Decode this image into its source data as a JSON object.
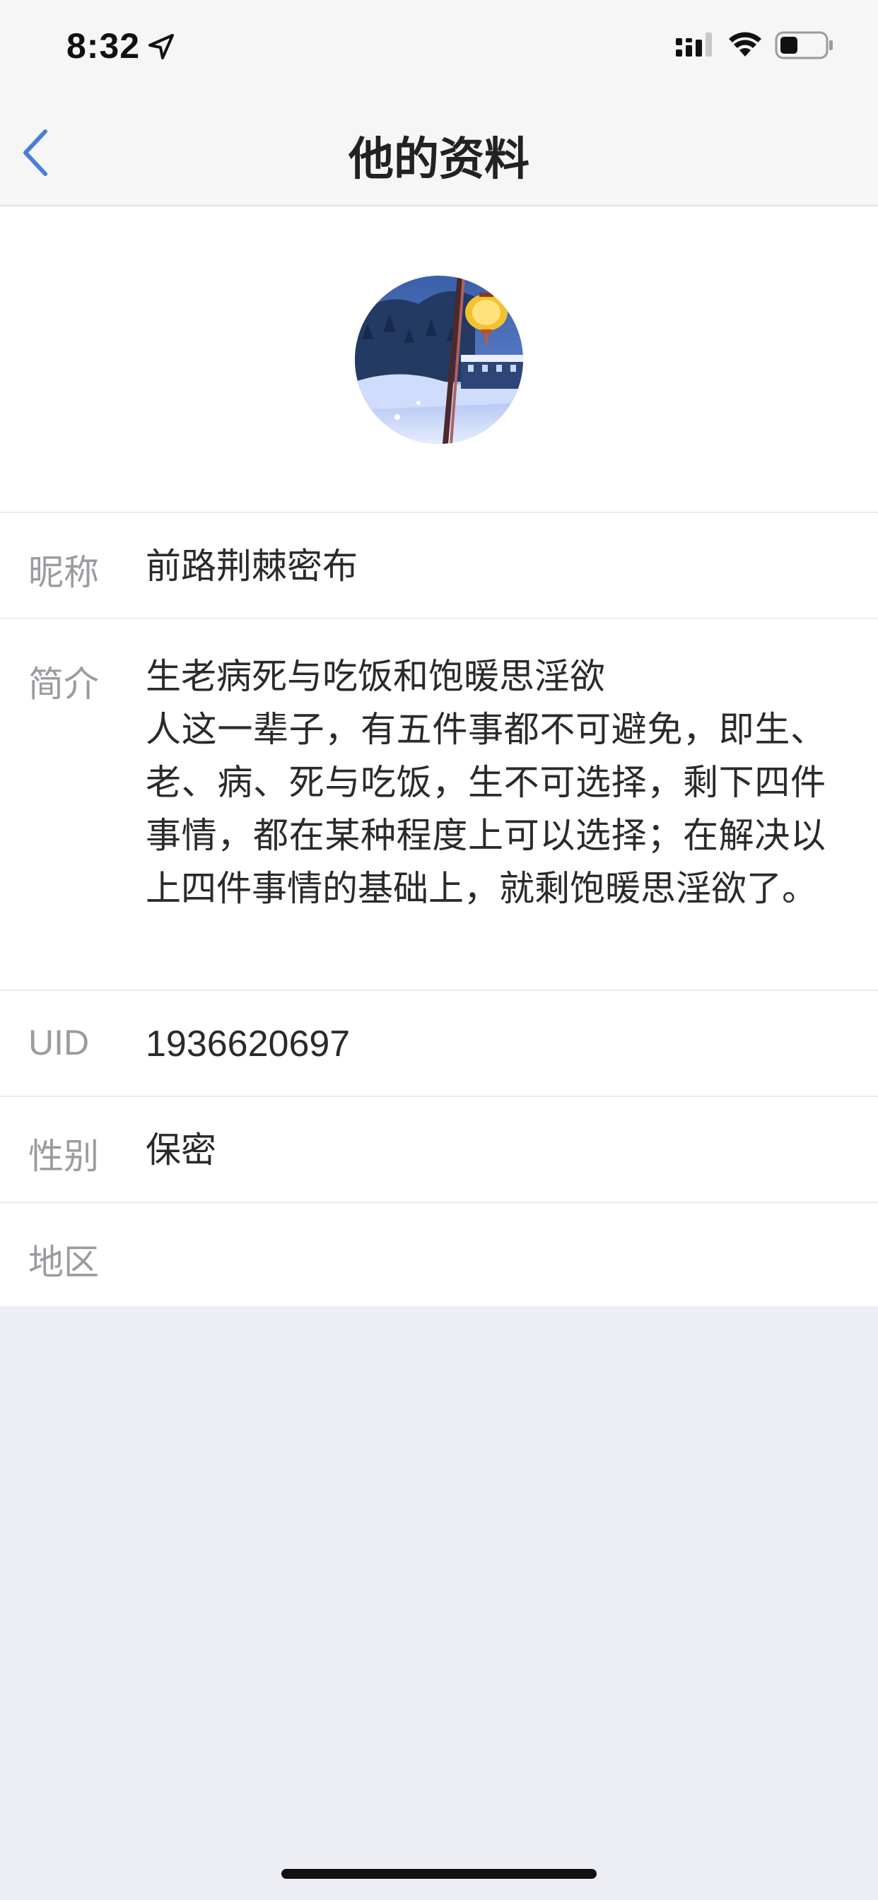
{
  "status_bar": {
    "time": "8:32",
    "icons": [
      "location-arrow-icon",
      "cellular-signal-icon",
      "wifi-icon",
      "battery-icon"
    ]
  },
  "nav": {
    "title": "他的资料",
    "back_icon": "chevron-left-icon",
    "accent_color": "#4a7fd6"
  },
  "profile": {
    "avatar": "avatar-photo",
    "rows": {
      "nickname": {
        "label": "昵称",
        "value": "前路荆棘密布"
      },
      "bio": {
        "label": "简介",
        "value": "生老病死与吃饭和饱暖思淫欲\n人这一辈子，有五件事都不可避免，即生、老、病、死与吃饭，生不可选择，剩下四件事情，都在某种程度上可以选择；在解决以上四件事情的基础上，就剩饱暖思淫欲了。"
      },
      "uid": {
        "label": "UID",
        "value": "1936620697"
      },
      "gender": {
        "label": "性别",
        "value": "保密"
      },
      "region": {
        "label": "地区",
        "value": ""
      }
    }
  }
}
